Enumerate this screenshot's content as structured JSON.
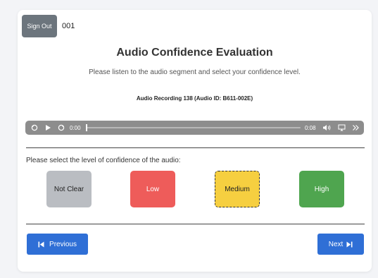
{
  "header": {
    "sign_out_label": "Sign Out",
    "user_id": "001"
  },
  "main": {
    "title": "Audio Confidence Evaluation",
    "subtitle": "Please listen to the audio segment and select your confidence level.",
    "recording_label": "Audio Recording 138 (Audio ID: B611-002E)"
  },
  "player": {
    "current_time": "0:00",
    "duration": "0:08",
    "progress": 0.0,
    "controls": [
      "replay-icon",
      "play-icon",
      "forward-icon",
      "volume-icon",
      "airplay-icon",
      "playback-speed-icon"
    ]
  },
  "confidence": {
    "prompt": "Please select the level of confidence of the audio:",
    "selected": "Medium",
    "options": [
      {
        "label": "Not Clear",
        "color": "#babdc2"
      },
      {
        "label": "Low",
        "color": "#ee5c5a"
      },
      {
        "label": "Medium",
        "color": "#f6cf40"
      },
      {
        "label": "High",
        "color": "#4fa54f"
      }
    ]
  },
  "navigation": {
    "previous_label": "Previous",
    "next_label": "Next"
  }
}
